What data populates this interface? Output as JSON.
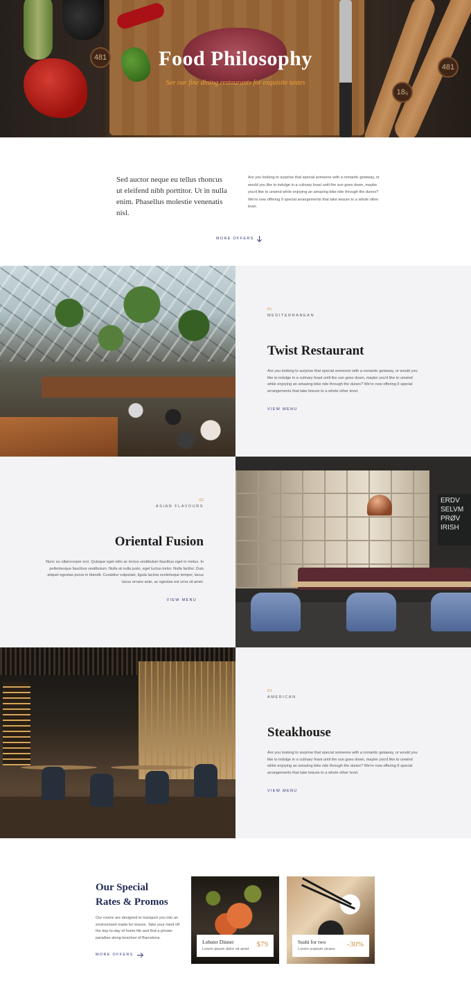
{
  "hero": {
    "title": "Food Philosophy",
    "subtitle": "See our fine dining restaurants for exquisite tastes",
    "tag_text": "481",
    "tag_text_2": "18₅"
  },
  "intro": {
    "quote": "Sed auctor neque eu tellus rhoncus ut eleifend nibh porttitor. Ut in nulla enim. Phasellus molestie venenatis nisl.",
    "text": "Are you looking to surprise that special someone with a romantic getaway, or would you like to indulge in a culinary feast until the sun goes down, maybe you'd like to unwind while enjoying an amazing bike ride through the dunes? We're now offering 9 special arrangements that take leisure to a whole other level.",
    "link": "MORE OFFERS"
  },
  "restaurants": [
    {
      "number": "01",
      "category": "MEDITERRANEAN",
      "title": "Twist Restaurant",
      "text": "Are you looking to surprise that special someone with a romantic getaway, or would you like to indulge in a culinary feast until the sun goes down, maybe you'd like to unwind while enjoying an amazing bike ride through the dunes? We're now offering 9 special arrangements that take leisure to a whole other level.",
      "link": "VIEW MENU"
    },
    {
      "number": "02",
      "category": "ASIAN FLAVOURS",
      "title": "Oriental Fusion",
      "text": "Nunc eu ullamcorper orci. Quisque eget odio ac lectus vestibulum faucibus eget in metus. In pellentesque faucibus vestibulum. Nulla at nulla justo, eget luctus tortor. Nulla facilisi. Duis aliquet egestas purus in blandit. Curabitur vulputate, ligula lacinia scelerisque tempor, lacus lacus ornare ante, ac egestas est urna sit amet.",
      "link": "VIEW MENU",
      "board_text": "ERDV SELVM PRØV IRISH"
    },
    {
      "number": "03",
      "category": "AMERICAN",
      "title": "Steakhouse",
      "text": "Are you looking to surprise that special someone with a romantic getaway, or would you like to indulge in a culinary feast until the sun goes down, maybe you'd like to unwind while enjoying an amazing bike ride through the dunes? We're now offering 9 special arrangements that take leisure to a whole other level.",
      "link": "VIEW MENU"
    }
  ],
  "promos": {
    "title_line1": "Our Special",
    "title_line2": "Rates & Promos",
    "text": "Our rooms are designed to transport you into an environment made for leisure. Take your mind off the day-to-day of home life and find a private paradise along beaches of Barcelona.",
    "link": "MORE OFFERS",
    "cards": [
      {
        "name": "Lobster Dinner",
        "desc": "Lorem ipsum dolor sit amet",
        "price": "$79"
      },
      {
        "name": "Sushi for two",
        "desc": "Lorem scipium sicans",
        "price": "-30%"
      }
    ]
  },
  "colors": {
    "accent": "#c8913f",
    "link": "#30337a",
    "panel": "#f3f3f5",
    "hero_subtitle": "#f2a33a"
  }
}
